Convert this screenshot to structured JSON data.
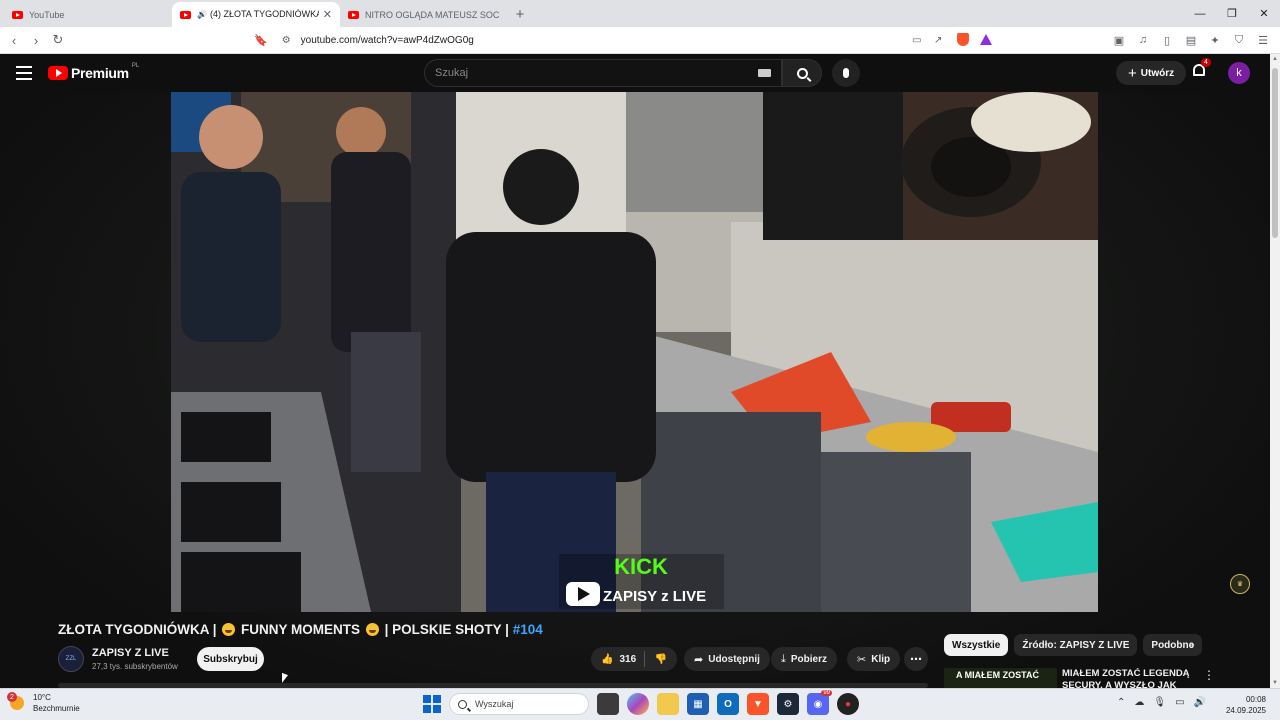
{
  "browser": {
    "tabs": [
      {
        "label": "YouTube",
        "active": false
      },
      {
        "label": "(4) ZŁOTA TYGODNIÓWKA | 😂",
        "active": true
      },
      {
        "label": "NITRO OGLĄDA MATEUSZ SOCHA E",
        "active": false
      }
    ],
    "url": "youtube.com/watch?v=awP4dZwOG0g"
  },
  "youtube": {
    "logo_word": "Premium",
    "logo_country": "PL",
    "search_placeholder": "Szukaj",
    "create_label": "Utwórz",
    "notification_count": "4",
    "avatar_letter": "k"
  },
  "video": {
    "title_part1": "ZŁOTA TYGODNIÓWKA |",
    "title_part2": "FUNNY MOMENTS",
    "title_part3": "| POLSKIE SHOTY |",
    "title_hashtag": "#104",
    "overlay_kick": "KICK",
    "overlay_brand": "ZAPISY z LIVE",
    "channel_name": "ZAPISY Z LIVE",
    "channel_subs": "27,3 tys. subskrybentów",
    "channel_avatar_text": "ZZL",
    "subscribe_label": "Subskrybuj",
    "likes": "316",
    "share_label": "Udostępnij",
    "download_label": "Pobierz",
    "clip_label": "Klip"
  },
  "sidebar": {
    "chips": [
      "Wszystkie",
      "Źródło: ZAPISY Z LIVE",
      "Podobne"
    ],
    "rec_thumb_text": "A MIAŁEM ZOSTAĆ",
    "rec_title": "MIAŁEM ZOSTAĆ LEGENDĄ SECURY, A WYSZŁO JAK"
  },
  "taskbar": {
    "temperature": "10°C",
    "weather": "Bezchmurnie",
    "weather_badge": "2",
    "search_label": "Wyszukaj",
    "discord_badge": "99",
    "time": "00:08",
    "date": "24.09.2025"
  },
  "colors": {
    "yt_red": "#ff0000",
    "hashtag_blue": "#3ea6ff",
    "avatar_purple": "#7b1fa2",
    "kick_green": "#53fc18"
  }
}
